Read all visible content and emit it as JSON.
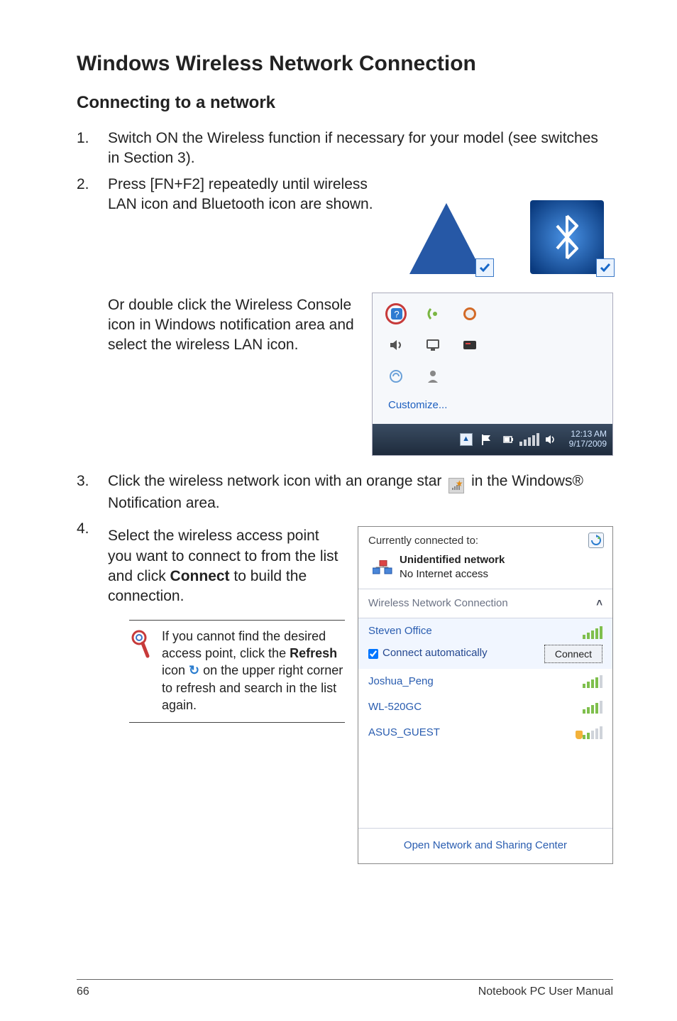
{
  "h1": "Windows Wireless Network Connection",
  "h2": "Connecting to a network",
  "steps": {
    "s1": {
      "num": "1.",
      "text": "Switch ON the Wireless function if necessary for your model (see switches in Section 3)."
    },
    "s2": {
      "num": "2.",
      "text": "Press [FN+F2] repeatedly until wireless LAN icon and Bluetooth icon are shown."
    },
    "s2b": {
      "text": "Or double click the Wireless Console icon in Windows notification area and select the wireless LAN icon."
    },
    "s3": {
      "num": "3.",
      "pre": "Click the wireless network icon with an orange star",
      "post": "in the Windows® Notification area."
    },
    "s4": {
      "num": "4.",
      "text_pre": "Select the wireless access point you want to connect to from the list and click ",
      "bold": "Connect",
      "text_post": " to build the connection."
    }
  },
  "note": {
    "pre": "If you cannot find the desired access point, click the ",
    "bold": "Refresh",
    "mid": " icon ",
    "post": " on the upper right corner to refresh and search in the list again."
  },
  "tray": {
    "customize": "Customize...",
    "clock_time": "12:13 AM",
    "clock_date": "9/17/2009"
  },
  "netfly": {
    "currently": "Currently connected to:",
    "unid_title": "Unidentified network",
    "unid_sub": "No Internet access",
    "section": "Wireless Network Connection",
    "ap_selected": "Steven Office",
    "auto": "Connect automatically",
    "connect": "Connect",
    "ap2": "Joshua_Peng",
    "ap3": "WL-520GC",
    "ap4": "ASUS_GUEST",
    "open_center": "Open Network and Sharing Center"
  },
  "footer": {
    "page": "66",
    "label": "Notebook PC User Manual"
  }
}
